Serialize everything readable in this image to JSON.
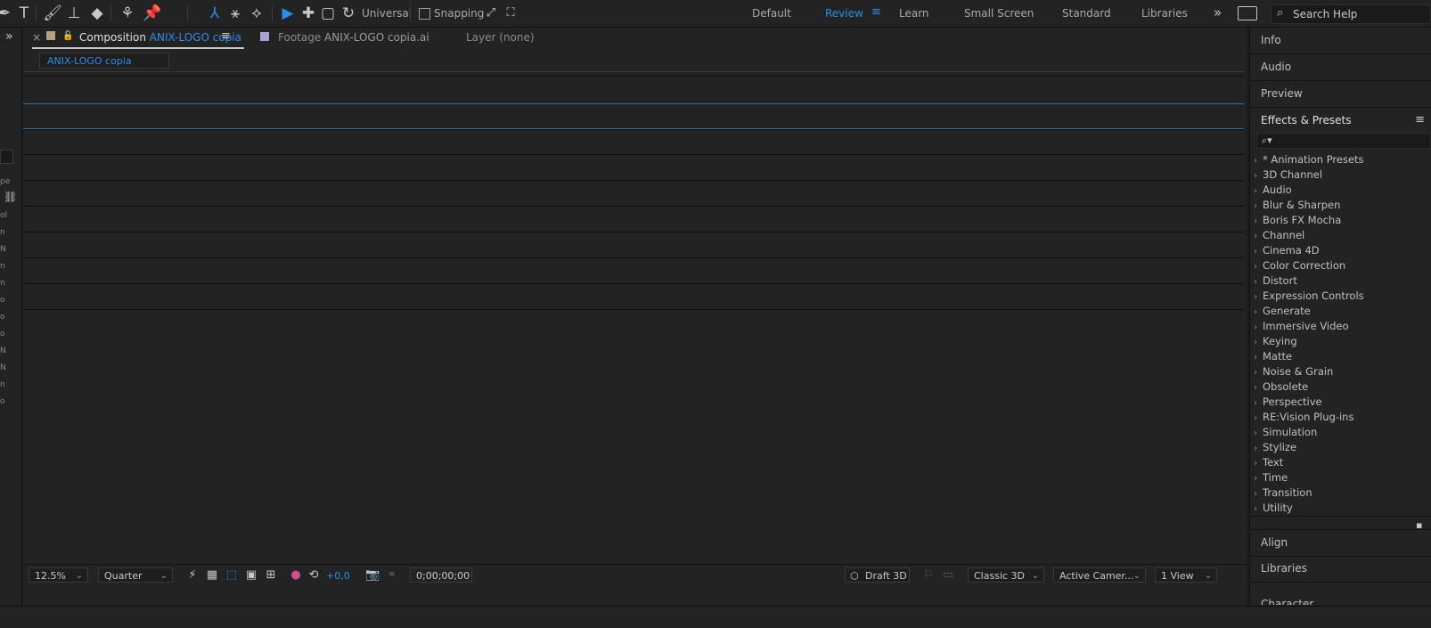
{
  "toolbar": {
    "tools": [
      "pen-tool-icon",
      "text-tool-icon",
      "brush-tool-icon",
      "clone-stamp-tool-icon",
      "eraser-tool-icon",
      "roto-brush-tool-icon",
      "puppet-pin-tool-icon",
      "local-axis-mode-icon",
      "world-axis-mode-icon",
      "view-axis-mode-icon",
      "selection-tool-icon",
      "move-tool-icon",
      "scale-tool-icon",
      "rotate-tool-icon"
    ],
    "universal_label": "Universal",
    "snapping_label": "Snapping",
    "workspaces": [
      "Default",
      "Review",
      "Learn",
      "Small Screen",
      "Standard",
      "Libraries"
    ],
    "active_workspace": "Review",
    "search_help_placeholder": "Search Help"
  },
  "left_strip": {
    "fragments": [
      "pe",
      "ol",
      "n",
      "N",
      "n",
      "n",
      "o",
      "o",
      "o",
      "N",
      "N",
      "n",
      "o"
    ]
  },
  "composition_panel": {
    "tab_comp_prefix": "Composition",
    "tab_comp_name": "ANIX-LOGO copia",
    "tab_footage_prefix": "Footage",
    "tab_footage_name": "ANIX-LOGO copia.ai",
    "tab_layer_label": "Layer (none)",
    "breadcrumb": "ANIX-LOGO copia"
  },
  "viewer_bar": {
    "zoom": "12.5%",
    "resolution": "Quarter",
    "exposure": "+0,0",
    "timecode": "0;00;00;00",
    "renderer": "Draft 3D",
    "renderer_mode": "Classic 3D",
    "camera": "Active Camer...",
    "views": "1 View"
  },
  "right_panels": {
    "info": "Info",
    "audio": "Audio",
    "preview": "Preview",
    "effects_presets": "Effects & Presets",
    "fx_search_placeholder": "⌕▾",
    "fx_categories": [
      "* Animation Presets",
      "3D Channel",
      "Audio",
      "Blur & Sharpen",
      "Boris FX Mocha",
      "Channel",
      "Cinema 4D",
      "Color Correction",
      "Distort",
      "Expression Controls",
      "Generate",
      "Immersive Video",
      "Keying",
      "Matte",
      "Noise & Grain",
      "Obsolete",
      "Perspective",
      "RE:Vision Plug-ins",
      "Simulation",
      "Stylize",
      "Text",
      "Time",
      "Transition",
      "Utility"
    ],
    "align": "Align",
    "libraries": "Libraries",
    "character": "Character"
  },
  "colors": {
    "accent": "#2d8ceb",
    "panel_bg": "#232323",
    "app_bg": "#1d1d1d"
  }
}
